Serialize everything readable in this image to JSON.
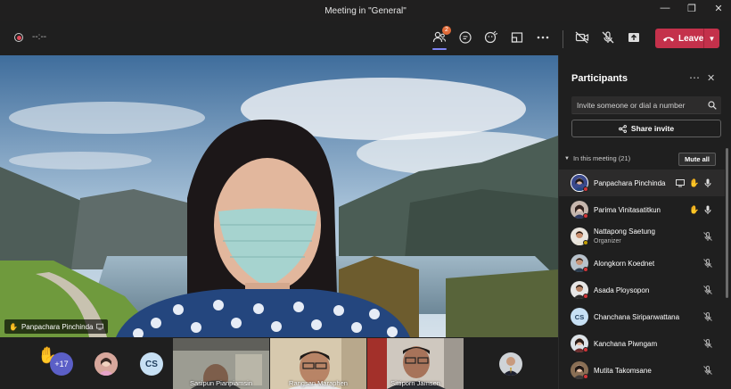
{
  "window": {
    "title": "Meeting in \"General\""
  },
  "toolbar": {
    "timer": "--:--",
    "participants_badge": "2",
    "leave_label": "Leave"
  },
  "colors": {
    "accent": "#7f85f5",
    "leave": "#c4314b",
    "badge": "#e06b39"
  },
  "stage": {
    "speaker_name": "Panpachara Pinchinda"
  },
  "strip": {
    "more_count": "+17",
    "initials": "CS",
    "tiles": [
      "Sasipun Pianpiamsin",
      "Rangsan Maraphen",
      "Sittiporn Jamsen"
    ]
  },
  "panel": {
    "title": "Participants",
    "invite_placeholder": "Invite someone or dial a number",
    "share_label": "Share invite",
    "section_label": "In this meeting (21)",
    "mute_all_label": "Mute all",
    "participants": [
      {
        "name": "Panpachara Pinchinda",
        "hand": true,
        "mic": "on",
        "share": true
      },
      {
        "name": "Parima Vinitasatitkun",
        "hand": true,
        "mic": "on"
      },
      {
        "name": "Nattapong Saetung",
        "role": "Organizer",
        "mic": "off"
      },
      {
        "name": "Alongkorn Koednet",
        "mic": "off"
      },
      {
        "name": "Asada Ploysopon",
        "mic": "off"
      },
      {
        "name": "Chanchana Siripanwattana",
        "initials": "CS",
        "mic": "off"
      },
      {
        "name": "Kanchana Piwngam",
        "mic": "off"
      },
      {
        "name": "Mutita Takomsane",
        "mic": "off"
      }
    ]
  }
}
